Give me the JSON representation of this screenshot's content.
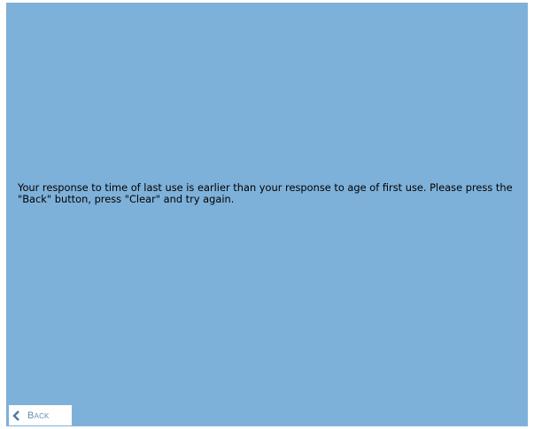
{
  "message": {
    "text": "Your response to time of last use is earlier than your response to age of first use. Please press the \"Back\" button, press \"Clear\" and try again."
  },
  "back_button": {
    "label": "Back",
    "icon": "chevron-left-icon"
  },
  "colors": {
    "panel_background": "#7eb1d9",
    "page_background": "#ffffff",
    "back_label": "#6a8dab",
    "back_icon": "#4a77a6"
  }
}
